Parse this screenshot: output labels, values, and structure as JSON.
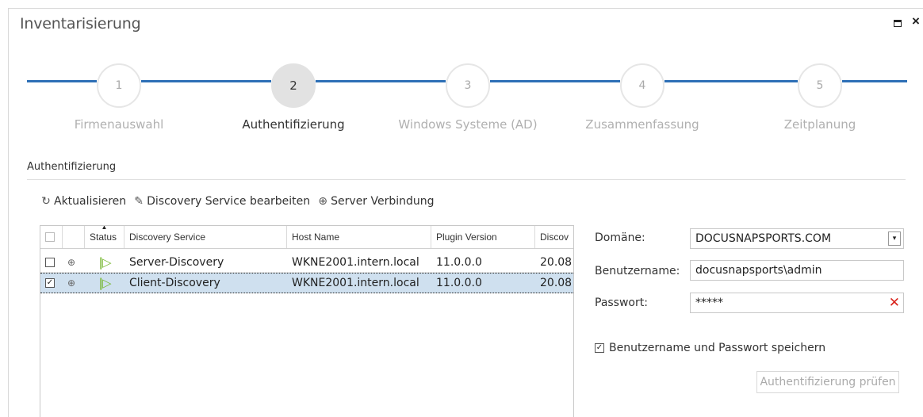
{
  "window": {
    "title": "Inventarisierung",
    "maximize_icon": "maximize-icon",
    "close_glyph": "×"
  },
  "wizard": {
    "accent_color": "#2e70b6",
    "current_step": 2,
    "steps": [
      {
        "number": "1",
        "label": "Firmenauswahl"
      },
      {
        "number": "2",
        "label": "Authentifizierung"
      },
      {
        "number": "3",
        "label": "Windows Systeme (AD)"
      },
      {
        "number": "4",
        "label": "Zusammenfassung"
      },
      {
        "number": "5",
        "label": "Zeitplanung"
      }
    ]
  },
  "section": {
    "title": "Authentifizierung"
  },
  "toolbar": {
    "refresh_label": "Aktualisieren",
    "edit_label": "Discovery Service bearbeiten",
    "connection_label": "Server Verbindung"
  },
  "grid": {
    "columns": {
      "status": "Status",
      "service": "Discovery Service",
      "host": "Host Name",
      "plugin": "Plugin Version",
      "discovery": "Discov"
    },
    "rows": [
      {
        "checked": false,
        "service": "Server-Discovery",
        "host": "WKNE2001.intern.local",
        "plugin": "11.0.0.0",
        "discovery": "20.08"
      },
      {
        "checked": true,
        "service": "Client-Discovery",
        "host": "WKNE2001.intern.local",
        "plugin": "11.0.0.0",
        "discovery": "20.08"
      }
    ]
  },
  "form": {
    "domain_label": "Domäne:",
    "domain_value": "DOCUSNAPSPORTS.COM",
    "username_label": "Benutzername:",
    "username_value": "docusnapsports\\admin",
    "password_label": "Passwort:",
    "password_value": "*****",
    "save_label": "Benutzername und Passwort speichern",
    "save_checked": true,
    "check_button_label": "Authentifizierung prüfen"
  }
}
